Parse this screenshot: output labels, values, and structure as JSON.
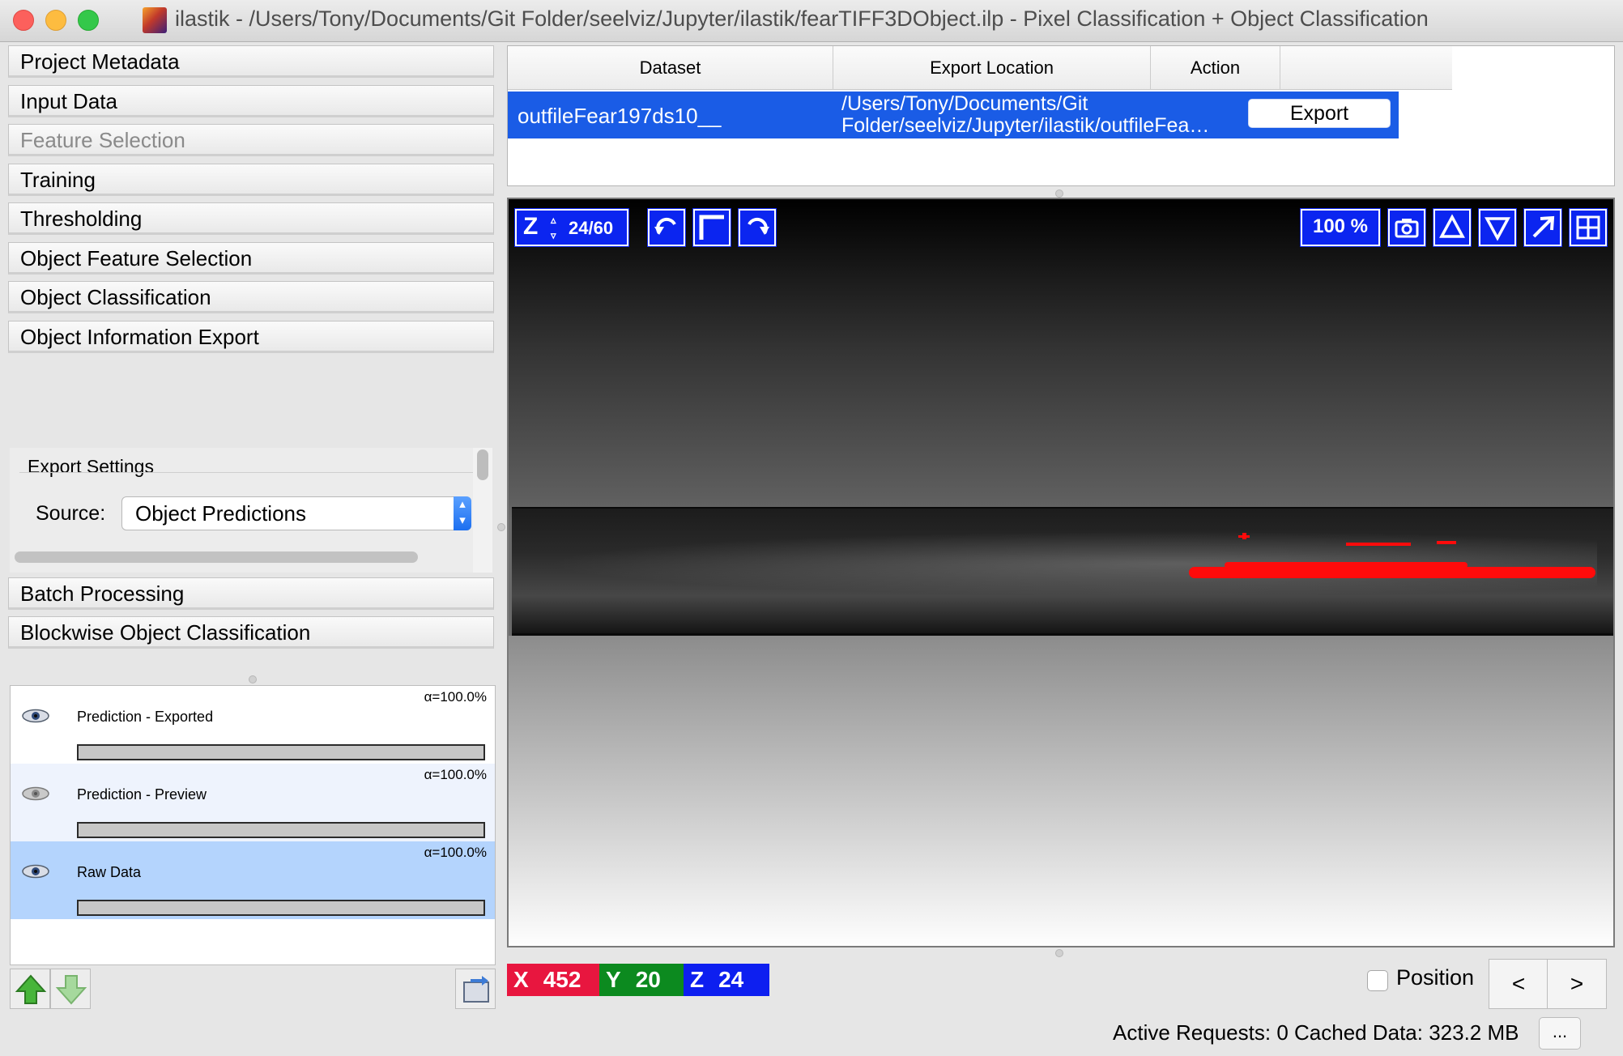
{
  "window": {
    "title": "ilastik - /Users/Tony/Documents/Git Folder/seelviz/Jupyter/ilastik/fearTIFF3DObject.ilp - Pixel Classification + Object Classification"
  },
  "applets": [
    {
      "label": "Project Metadata"
    },
    {
      "label": "Input Data"
    },
    {
      "label": "Feature Selection"
    },
    {
      "label": "Training"
    },
    {
      "label": "Thresholding"
    },
    {
      "label": "Object Feature Selection"
    },
    {
      "label": "Object Classification"
    },
    {
      "label": "Object Information Export"
    },
    {
      "label": "Batch Processing"
    },
    {
      "label": "Blockwise Object Classification"
    }
  ],
  "export_settings": {
    "title": "Export Settings",
    "source_label": "Source:",
    "source_value": "Object Predictions"
  },
  "layers": [
    {
      "name": "Prediction - Exported",
      "alpha": "α=100.0%",
      "opacity": 1.0
    },
    {
      "name": "Prediction - Preview",
      "alpha": "α=100.0%",
      "opacity": 1.0
    },
    {
      "name": "Raw Data",
      "alpha": "α=100.0%",
      "opacity": 1.0
    }
  ],
  "table": {
    "headers": [
      "Dataset",
      "Export Location",
      "Action"
    ],
    "row": {
      "dataset": "outfileFear197ds10__",
      "location_line1": "/Users/Tony/Documents/Git",
      "location_line2": "Folder/seelviz/Jupyter/ilastik/outfileFea…",
      "action": "Export"
    }
  },
  "viewer": {
    "z_axis": "Z",
    "z_slice": "24/60",
    "zoom": "100 %"
  },
  "coords": {
    "x_label": "X",
    "x": "452",
    "y_label": "Y",
    "y": "20",
    "z_label": "Z",
    "z": "24",
    "colors": {
      "x": "#e8163f",
      "y": "#0c8a1f",
      "z": "#0d1ff0"
    }
  },
  "position": {
    "label": "Position",
    "checked": false
  },
  "nav": {
    "prev": "<",
    "next": ">"
  },
  "status": {
    "text": "Active Requests: 0  Cached Data: 323.2 MB",
    "more": "..."
  },
  "icons": {
    "undo": "rotate-left-icon",
    "fit": "corner-bracket-icon",
    "redo": "rotate-right-icon",
    "snapshot": "camera-icon",
    "up": "triangle-up-icon",
    "down": "triangle-down-icon",
    "maximize": "arrow-diagonal-icon",
    "grid": "grid-icon"
  }
}
